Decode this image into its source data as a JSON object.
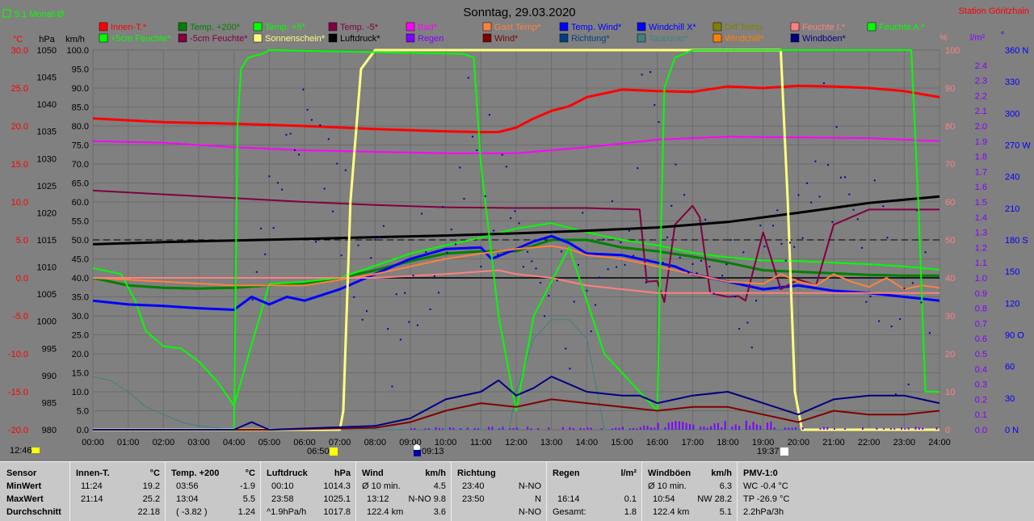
{
  "header": {
    "title": "Sonntag, 29.03.2020",
    "station": "Station Göritzhain",
    "period_toggle": "5:1 Monat-Ø"
  },
  "axes": {
    "left_units": [
      "°C",
      "hPa",
      "km/h"
    ],
    "right_units": [
      "%",
      "l/m²",
      "°"
    ],
    "temp_ticks": [
      "30.0",
      "25.0",
      "20.0",
      "15.0",
      "10.0",
      "5.0",
      "0.0",
      "-5.0",
      "-10.0",
      "-15.0",
      "-20.0"
    ],
    "pressure_ticks": [
      "1050",
      "1045",
      "1040",
      "1035",
      "1030",
      "1025",
      "1020",
      "1015",
      "1010",
      "1005",
      "1000",
      "995",
      "990",
      "985",
      "980"
    ],
    "speed_ticks": [
      "100.0",
      "95.0",
      "90.0",
      "85.0",
      "80.0",
      "75.0",
      "70.0",
      "65.0",
      "60.0",
      "55.0",
      "50.0",
      "45.0",
      "40.0",
      "35.0",
      "30.0",
      "25.0",
      "20.0",
      "15.0",
      "10.0",
      "5.0",
      "0.0"
    ],
    "humidity_ticks": [
      "100",
      "90",
      "80",
      "70",
      "60",
      "50",
      "40",
      "30",
      "20",
      "10",
      "0"
    ],
    "rain_ticks": [
      "2.4",
      "2.3",
      "2.2",
      "2.1",
      "2.0",
      "1.9",
      "1.8",
      "1.7",
      "1.6",
      "1.5",
      "1.4",
      "1.3",
      "1.2",
      "1.1",
      "1.0",
      "0.9",
      "0.8",
      "0.7",
      "0.6",
      "0.5",
      "0.4",
      "0.3",
      "0.2",
      "0.1",
      "0.0"
    ],
    "direction_ticks": [
      "360 N",
      "330",
      "300",
      "270 W",
      "240",
      "210",
      "180 S",
      "150",
      "120",
      "90 O",
      "60",
      "30",
      "0 N"
    ],
    "time_ticks": [
      "00:00",
      "01:00",
      "02:00",
      "03:00",
      "04:00",
      "05:00",
      "06:00",
      "07:00",
      "08:00",
      "09:00",
      "10:00",
      "11:00",
      "12:00",
      "13:00",
      "14:00",
      "15:00",
      "16:00",
      "17:00",
      "18:00",
      "19:00",
      "20:00",
      "21:00",
      "22:00",
      "23:00",
      "24:00"
    ]
  },
  "markers": {
    "left_time": "12:46",
    "sunrise": "06:50",
    "moon": "09:13",
    "sunset": "19:37"
  },
  "legend": [
    {
      "label": "Innen-T.*",
      "color": "#ff0000"
    },
    {
      "label": "Temp. +200*",
      "color": "#008000"
    },
    {
      "label": "Temp. +5*",
      "color": "#00ff00"
    },
    {
      "label": "Temp. -5*",
      "color": "#800040"
    },
    {
      "label": "Bad*",
      "color": "#ff00ff"
    },
    {
      "label": "Gast Temp*",
      "color": "#ff8040"
    },
    {
      "label": "Temp. Wind*",
      "color": "#0000ff"
    },
    {
      "label": "Windchill X*",
      "color": "#0000ff"
    },
    {
      "label": "Diff Temp.",
      "color": "#808000"
    },
    {
      "label": "Feuchte I.*",
      "color": "#ff8080"
    },
    {
      "label": "Feuchte A.*",
      "color": "#00ff00"
    },
    {
      "label": "+5cm Feuchte*",
      "color": "#00ff00"
    },
    {
      "label": "-5cm Feuchte*",
      "color": "#800040"
    },
    {
      "label": "Sonnenschein*",
      "color": "#ffff80"
    },
    {
      "label": "Luftdruck*",
      "color": "#000000"
    },
    {
      "label": "Regen",
      "color": "#8000ff"
    },
    {
      "label": "Wind*",
      "color": "#800000"
    },
    {
      "label": "Richtung*",
      "color": "#004080"
    },
    {
      "label": "Taupunkt*",
      "color": "#408080"
    },
    {
      "label": "Windchill*",
      "color": "#ff8000"
    },
    {
      "label": "Windböen*",
      "color": "#000080"
    }
  ],
  "chart_data": {
    "type": "line",
    "title": "Sonntag, 29.03.2020",
    "x_unit": "hour of day",
    "x_range": [
      0,
      24
    ],
    "scales": {
      "temperature_C": [
        -20,
        30
      ],
      "pressure_hPa": [
        980,
        1050
      ],
      "wind_kmh": [
        0,
        100
      ],
      "humidity_pct": [
        0,
        100
      ],
      "rain_lm2": [
        0,
        2.5
      ],
      "direction_deg": [
        0,
        360
      ]
    },
    "series": [
      {
        "name": "Innen-T.*",
        "scale": "temperature_C",
        "color": "#ff0000",
        "width": 3,
        "x": [
          0,
          2,
          4,
          6,
          8,
          10,
          11,
          11.5,
          12,
          12.5,
          13,
          13.5,
          14,
          15,
          16,
          17,
          18,
          19,
          20,
          21,
          22,
          23,
          24
        ],
        "y": [
          21.0,
          20.5,
          20.3,
          20.0,
          19.6,
          19.3,
          19.2,
          19.2,
          19.8,
          21.0,
          22.0,
          22.6,
          23.8,
          24.8,
          24.6,
          24.5,
          25.2,
          25.0,
          25.3,
          25.2,
          25.0,
          24.6,
          23.8
        ]
      },
      {
        "name": "Temp. +200*",
        "scale": "temperature_C",
        "color": "#008000",
        "width": 3,
        "x": [
          0,
          1,
          2,
          3,
          4,
          5,
          6,
          7,
          8,
          9,
          10,
          11,
          12,
          13,
          14,
          15,
          16,
          17,
          18,
          19,
          20,
          21,
          22,
          23,
          24
        ],
        "y": [
          0.0,
          -1.0,
          -1.3,
          -1.4,
          -1.3,
          -1.0,
          -0.8,
          0.0,
          1.0,
          2.2,
          3.2,
          3.5,
          3.5,
          5.0,
          5.0,
          4.0,
          3.5,
          2.8,
          2.0,
          1.0,
          0.8,
          0.6,
          0.4,
          0.3,
          0.3
        ]
      },
      {
        "name": "Temp. +5*",
        "scale": "temperature_C",
        "color": "#00ff00",
        "width": 2,
        "x": [
          0,
          0.8,
          1.2,
          1.5,
          2.0,
          2.5,
          3.0,
          3.5,
          4.0,
          5,
          6,
          7,
          8,
          9,
          10,
          11,
          12,
          13,
          14,
          15,
          16,
          17,
          18,
          19,
          20,
          21,
          22,
          23,
          24
        ],
        "y": [
          1.3,
          0.5,
          -3.0,
          -7.0,
          -9.0,
          -9.3,
          -11.0,
          -13.5,
          -16.8,
          -0.8,
          -0.5,
          0.0,
          1.6,
          3.2,
          4.3,
          5.3,
          6.5,
          7.2,
          6.0,
          5.0,
          4.3,
          3.3,
          2.7,
          2.3,
          2.2,
          2.0,
          1.8,
          1.5,
          1.1
        ]
      },
      {
        "name": "Temp. Wind*",
        "scale": "temperature_C",
        "color": "#0000ff",
        "width": 3,
        "x": [
          0,
          1,
          2,
          3,
          4,
          4.5,
          5,
          5.5,
          6,
          7,
          8,
          9,
          10,
          11,
          11.3,
          12,
          12.5,
          13,
          13.5,
          14,
          15,
          16,
          16.5,
          17,
          18,
          19,
          20,
          21,
          22,
          23,
          24
        ],
        "y": [
          -3.0,
          -3.5,
          -3.7,
          -4.0,
          -4.2,
          -2.5,
          -3.5,
          -2.5,
          -3.0,
          -1.5,
          0.5,
          2.5,
          3.8,
          4.0,
          2.5,
          3.8,
          4.8,
          5.5,
          4.6,
          3.2,
          3.0,
          2.0,
          1.5,
          0.5,
          -0.5,
          -1.5,
          -1.0,
          -1.7,
          -2.0,
          -2.5,
          -3.0
        ]
      },
      {
        "name": "Bad*",
        "scale": "temperature_C",
        "color": "#ff00ff",
        "width": 2,
        "x": [
          0,
          2,
          4,
          6,
          8,
          10,
          12,
          14,
          16,
          18,
          20,
          22,
          24
        ],
        "y": [
          18.0,
          17.8,
          17.2,
          16.8,
          16.6,
          16.4,
          16.4,
          17.2,
          18.2,
          18.6,
          18.5,
          18.4,
          18.0
        ]
      },
      {
        "name": "Temp. -5*",
        "scale": "temperature_C",
        "color": "#800040",
        "width": 2,
        "x": [
          0,
          2,
          4,
          6,
          8,
          10,
          12,
          14,
          15.5,
          15.7,
          16,
          16.2,
          16.5,
          17,
          17.2,
          17.5,
          18,
          18.3,
          18.5,
          19,
          19.5,
          20,
          20.5,
          21,
          22,
          23,
          24
        ],
        "y": [
          11.5,
          11.0,
          10.5,
          10.0,
          9.6,
          9.3,
          9.2,
          9.2,
          9.0,
          -0.5,
          -0.4,
          -3.2,
          7.0,
          9.5,
          8.0,
          -2.0,
          -2.5,
          -2.4,
          -3.0,
          6.0,
          -1.5,
          -0.2,
          -1.0,
          7.0,
          9.0,
          9.0,
          9.0
        ]
      },
      {
        "name": "Gast Temp*",
        "scale": "temperature_C",
        "color": "#ff8040",
        "width": 2,
        "x": [
          0,
          4,
          6,
          8,
          10,
          11,
          12,
          12.5,
          13,
          13.5,
          14,
          15,
          16,
          17,
          18,
          19,
          19.5,
          20,
          20.5,
          21,
          21.5,
          22,
          22.5,
          23,
          23.5,
          24
        ],
        "y": [
          0.0,
          -1.0,
          -1.0,
          0.5,
          2.5,
          3.2,
          3.8,
          4.0,
          4.2,
          3.8,
          3.0,
          2.5,
          1.5,
          0.5,
          -0.5,
          -0.8,
          0.5,
          -0.5,
          -1.0,
          0.5,
          -0.5,
          -1.2,
          0.0,
          -1.5,
          -1.0,
          -1.3
        ]
      },
      {
        "name": "Luftdruck*",
        "scale": "pressure_hPa",
        "color": "#000000",
        "width": 3,
        "x": [
          0,
          2,
          4,
          6,
          8,
          10,
          12,
          14,
          16,
          18,
          20,
          22,
          24
        ],
        "y": [
          1014.2,
          1014.6,
          1014.9,
          1015.2,
          1015.5,
          1015.8,
          1016.2,
          1016.7,
          1017.3,
          1018.3,
          1020.0,
          1021.8,
          1023.0
        ]
      },
      {
        "name": "Feuchte I.*",
        "scale": "humidity_pct",
        "color": "#ff8080",
        "width": 2,
        "x": [
          0,
          4,
          8,
          10,
          11.5,
          12,
          13,
          14,
          15,
          16,
          17,
          18,
          20,
          22,
          24
        ],
        "y": [
          40,
          40,
          40,
          41,
          42,
          41,
          40,
          38,
          37,
          36,
          36,
          36,
          36,
          36,
          36
        ]
      },
      {
        "name": "Taupunkt*",
        "scale": "humidity_pct",
        "color": "#408080",
        "width": 1,
        "x": [
          0,
          0.5,
          1,
          1.5,
          2,
          2.5,
          3,
          4,
          5,
          8,
          11.8,
          12,
          12.5,
          13,
          13.5,
          14,
          14.3,
          14.5,
          15,
          16,
          17,
          20,
          22,
          23,
          23.2,
          24
        ],
        "y": [
          14,
          13,
          10,
          6,
          4,
          2,
          1,
          0,
          0,
          0,
          0,
          10,
          24,
          29,
          29,
          24,
          10,
          0,
          0,
          0,
          0,
          0,
          0,
          0,
          0,
          0
        ]
      },
      {
        "name": "Sonnenschein*",
        "scale": "humidity_pct",
        "color": "#ffff80",
        "width": 3,
        "x": [
          0,
          7.0,
          7.1,
          7.3,
          7.6,
          8.0,
          19.5,
          19.7,
          19.9,
          20.1,
          24
        ],
        "y": [
          0,
          0,
          5,
          60,
          95,
          100,
          100,
          60,
          10,
          0,
          0
        ]
      },
      {
        "name": "Feuchte A.*",
        "scale": "humidity_pct",
        "color": "#00ff00",
        "width": 2,
        "x": [
          0,
          4.0,
          4.1,
          4.2,
          4.4,
          4.8,
          5,
          10.5,
          10.8,
          11.0,
          11.5,
          12.0,
          12.5,
          13.5,
          14.5,
          15.5,
          16.0,
          16.1,
          16.2,
          16.5,
          17.0,
          23.2,
          23.4,
          23.6,
          24
        ],
        "y": [
          0,
          0,
          80,
          95,
          98,
          99,
          100,
          99,
          98,
          70,
          30,
          5,
          30,
          48,
          20,
          10,
          5,
          50,
          90,
          98,
          100,
          100,
          60,
          10,
          10
        ]
      },
      {
        "name": "Wind*",
        "scale": "wind_kmh",
        "color": "#800000",
        "width": 2,
        "x": [
          0,
          5,
          8,
          9,
          10,
          11,
          12,
          13,
          14,
          15,
          16,
          17,
          18,
          19,
          20,
          21,
          22,
          23,
          24
        ],
        "y": [
          0,
          0,
          0.5,
          2,
          5,
          7,
          6,
          8,
          7,
          6,
          5,
          6,
          6,
          4,
          2,
          5,
          4,
          4,
          5
        ]
      },
      {
        "name": "Windböen*",
        "scale": "wind_kmh",
        "color": "#000080",
        "width": 2,
        "x": [
          0,
          4,
          4.5,
          5,
          8,
          9,
          10,
          11,
          11.5,
          12,
          12.5,
          13,
          14,
          15,
          15.5,
          16,
          17,
          18,
          19,
          20,
          21,
          22,
          23,
          24
        ],
        "y": [
          0,
          0,
          2,
          0,
          1,
          3,
          8,
          10,
          13,
          9,
          11,
          14,
          10,
          9,
          9,
          7,
          9,
          10,
          7,
          4,
          8,
          9,
          9,
          7
        ]
      }
    ]
  },
  "stats": {
    "headers": {
      "sensor": "Sensor",
      "innen": "Innen-T.",
      "innen_unit": "°C",
      "temp200": "Temp. +200",
      "temp200_unit": "°C",
      "druck": "Luftdruck",
      "druck_unit": "hPa",
      "wind": "Wind",
      "wind_unit": "km/h",
      "richtung": "Richtung",
      "regen": "Regen",
      "regen_unit": "l/m²",
      "boeen": "Windböen",
      "boeen_unit": "km/h",
      "pmv": "PMV-1:0"
    },
    "row_labels": [
      "MinWert",
      "MaxWert",
      "Durchschnitt"
    ],
    "innen": [
      [
        "11:24",
        "19.2"
      ],
      [
        "21:14",
        "25.2"
      ],
      [
        "",
        "22.18"
      ]
    ],
    "temp200": [
      [
        "03:56",
        "-1.9"
      ],
      [
        "13:04",
        "5.5"
      ],
      [
        "( -3.82 )",
        "1.24"
      ]
    ],
    "druck": [
      [
        "00:10",
        "1014.3"
      ],
      [
        "23:58",
        "1025.1"
      ],
      [
        "^1.9hPa/h",
        "1017.8"
      ]
    ],
    "wind": [
      [
        "Ø 10 min.",
        "",
        "4.5"
      ],
      [
        "13:12",
        "N-NO 9.8",
        ""
      ],
      [
        "122.4 km",
        "",
        "3.6"
      ]
    ],
    "richtung": [
      [
        "23:40",
        "N-NO"
      ],
      [
        "23:50",
        "N"
      ],
      [
        "",
        "N-NO"
      ]
    ],
    "regen": [
      [
        "",
        ""
      ],
      [
        "16:14",
        "0.1"
      ],
      [
        "Gesamt:",
        "1.8"
      ]
    ],
    "boeen": [
      [
        "Ø 10 min.",
        "6.3"
      ],
      [
        "10:54",
        "NW 28.2"
      ],
      [
        "122.4 km",
        "5.1"
      ]
    ],
    "pmv": [
      "WC -0.4 °C",
      "TP -26.9 °C",
      "2.2hPa/3h"
    ]
  }
}
